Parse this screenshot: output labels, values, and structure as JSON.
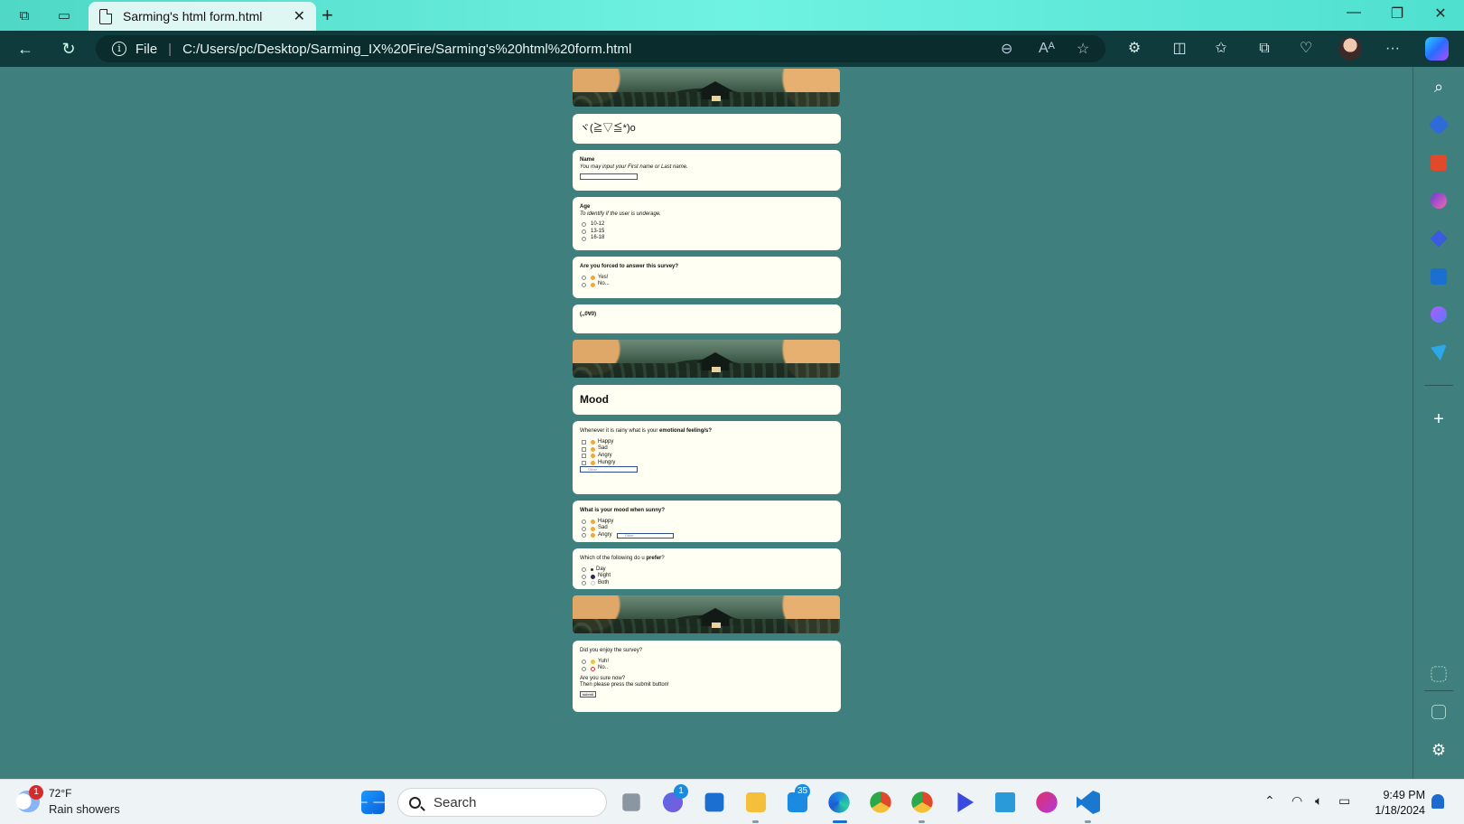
{
  "browser": {
    "tab_title": "Sarming's html form.html",
    "file_label": "File",
    "url": "C:/Users/pc/Desktop/Sarming_IX%20Fire/Sarming's%20html%20form.html"
  },
  "form": {
    "greeting": "ヾ(≧▽≦*)o",
    "name": {
      "label": "Name",
      "hint": "You may input your First name or Last name.",
      "value": ""
    },
    "age": {
      "label": "Age",
      "hint": "To identify if the user is underage.",
      "options": [
        "10-12",
        "13-15",
        "16-18"
      ]
    },
    "forced": {
      "question": "Are you forced to answer this survey?",
      "options": [
        "Yes!",
        "No..."
      ]
    },
    "ok": "(,,0∀0)",
    "mood_title": "Mood",
    "rainy": {
      "question_prefix": "Whenever it is rainy what is your ",
      "question_bold": "emotional feeling/s?",
      "options": [
        "Happy",
        "Sad",
        "Angry",
        "Hungry"
      ],
      "other_placeholder": "Other"
    },
    "sunny": {
      "question": "What is your mood when sunny?",
      "options": [
        "Happy",
        "Sad",
        "Angry"
      ],
      "other_placeholder": "Other"
    },
    "prefer": {
      "question_prefix": "Which of the following do u ",
      "question_bold": "prefer",
      "question_suffix": "?",
      "options": [
        "Day",
        "Night",
        "Both"
      ]
    },
    "enjoy": {
      "question": "Did you enjoy the survey?",
      "options": [
        "Yuh!",
        "No.."
      ],
      "confirm_1": "Are you sure now?",
      "confirm_2": "Then please press the submit button!",
      "submit_label": "submit"
    }
  },
  "taskbar": {
    "weather_temp": "72°F",
    "weather_desc": "Rain showers",
    "weather_badge": "1",
    "search_placeholder": "Search",
    "teams_badge": "1",
    "mail_badge": "35",
    "time": "9:49 PM",
    "date": "1/18/2024"
  },
  "colors": {
    "page_background": "#3f807e",
    "card_background": "#fffff3",
    "titlebar_accent": "#6ff2e2",
    "address_bar": "#0f3b3c"
  }
}
